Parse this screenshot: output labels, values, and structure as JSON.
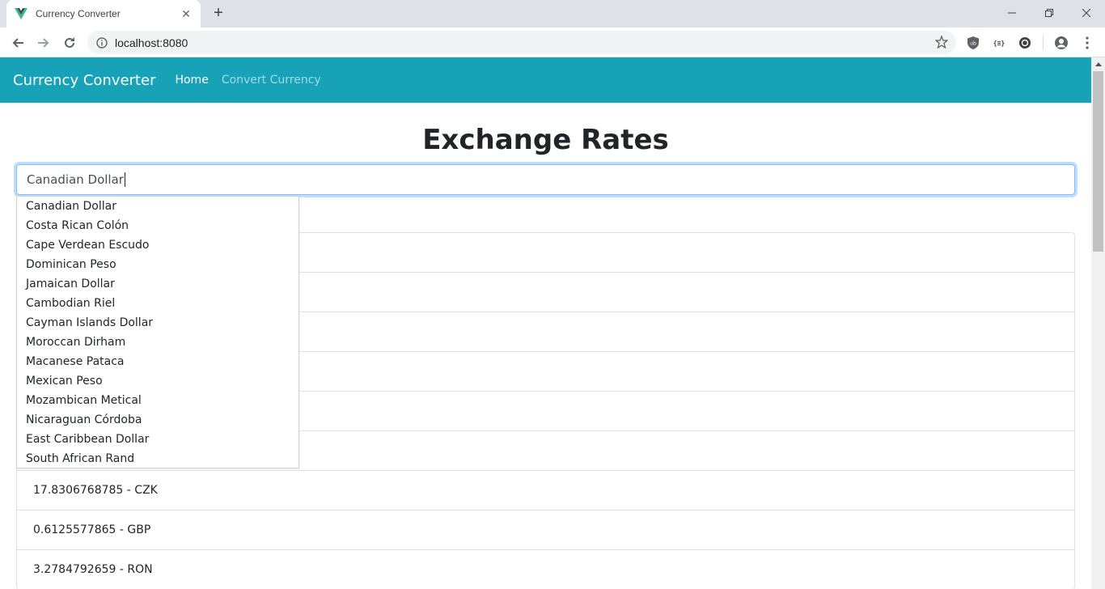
{
  "browser": {
    "tab_title": "Currency Converter",
    "url": "localhost:8080"
  },
  "navbar": {
    "brand": "Currency Converter",
    "links": [
      {
        "label": "Home",
        "active": true
      },
      {
        "label": "Convert Currency",
        "active": false
      }
    ],
    "color": "#17a2b8"
  },
  "main": {
    "title": "Exchange Rates",
    "search": {
      "value": "Canadian Dollar"
    },
    "suggestions": [
      "Canadian Dollar",
      "Costa Rican Colón",
      "Cape Verdean Escudo",
      "Dominican Peso",
      "Jamaican Dollar",
      "Cambodian Riel",
      "Cayman Islands Dollar",
      "Moroccan Dirham",
      "Macanese Pataca",
      "Mexican Peso",
      "Mozambican Metical",
      "Nicaraguan Córdoba",
      "East Caribbean Dollar",
      "South African Rand"
    ],
    "rates": [
      "",
      "",
      "",
      "",
      "",
      "",
      "17.8306768785 - CZK",
      "0.6125577865 - GBP",
      "3.2784792659 - RON"
    ]
  }
}
